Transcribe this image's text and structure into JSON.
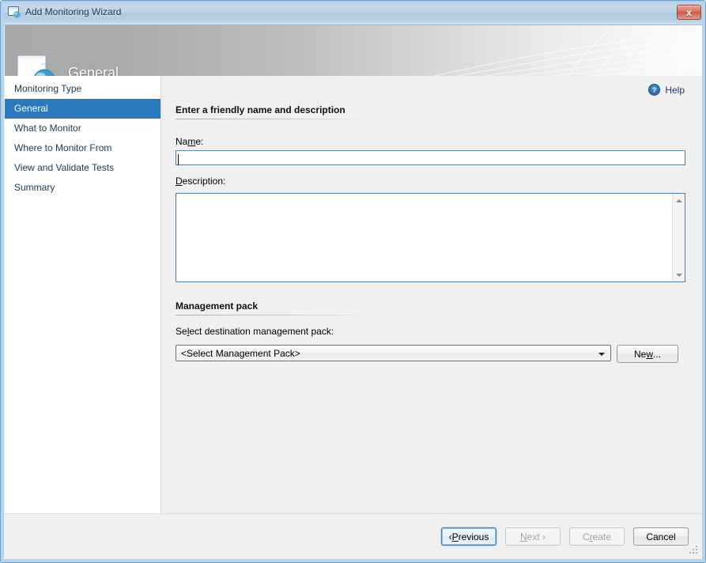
{
  "window": {
    "title": "Add Monitoring Wizard",
    "title_icon": "window-sphere-icon",
    "close_label": "x"
  },
  "banner": {
    "heading": "General",
    "icon": "window-sphere-icon"
  },
  "sidebar": {
    "items": [
      {
        "label": "Monitoring Type",
        "selected": false
      },
      {
        "label": "General",
        "selected": true
      },
      {
        "label": "What to Monitor",
        "selected": false
      },
      {
        "label": "Where to Monitor From",
        "selected": false
      },
      {
        "label": "View and Validate Tests",
        "selected": false
      },
      {
        "label": "Summary",
        "selected": false
      }
    ]
  },
  "content": {
    "help_label": "Help",
    "help_icon": "help-question-icon",
    "section_general": {
      "heading": "Enter a friendly name and description",
      "name_label_pre": "Na",
      "name_label_acc": "m",
      "name_label_post": "e:",
      "name_value": "",
      "name_placeholder": "",
      "description_label_acc": "D",
      "description_label_post": "escription:",
      "description_value": "",
      "description_placeholder": ""
    },
    "section_mp": {
      "heading": "Management pack",
      "select_label_pre": "Se",
      "select_label_acc": "l",
      "select_label_post": "ect destination management pack:",
      "combo_value": "<Select Management Pack>",
      "new_label_pre": "Ne",
      "new_label_acc": "w",
      "new_label_post": "..."
    }
  },
  "footer": {
    "previous_pre": "‹ ",
    "previous_acc": "P",
    "previous_post": "revious",
    "next_pre": "",
    "next_acc": "N",
    "next_post": "ext ›",
    "create_pre": "C",
    "create_acc": "r",
    "create_post": "eate",
    "cancel_label": "Cancel"
  },
  "colors": {
    "accent_selected": "#2b7ac0",
    "titlebar": "#bfd5e8",
    "close_red": "#c85b46",
    "dialog_bg": "#f0f0f0",
    "sidebar_bg": "#ffffff"
  }
}
